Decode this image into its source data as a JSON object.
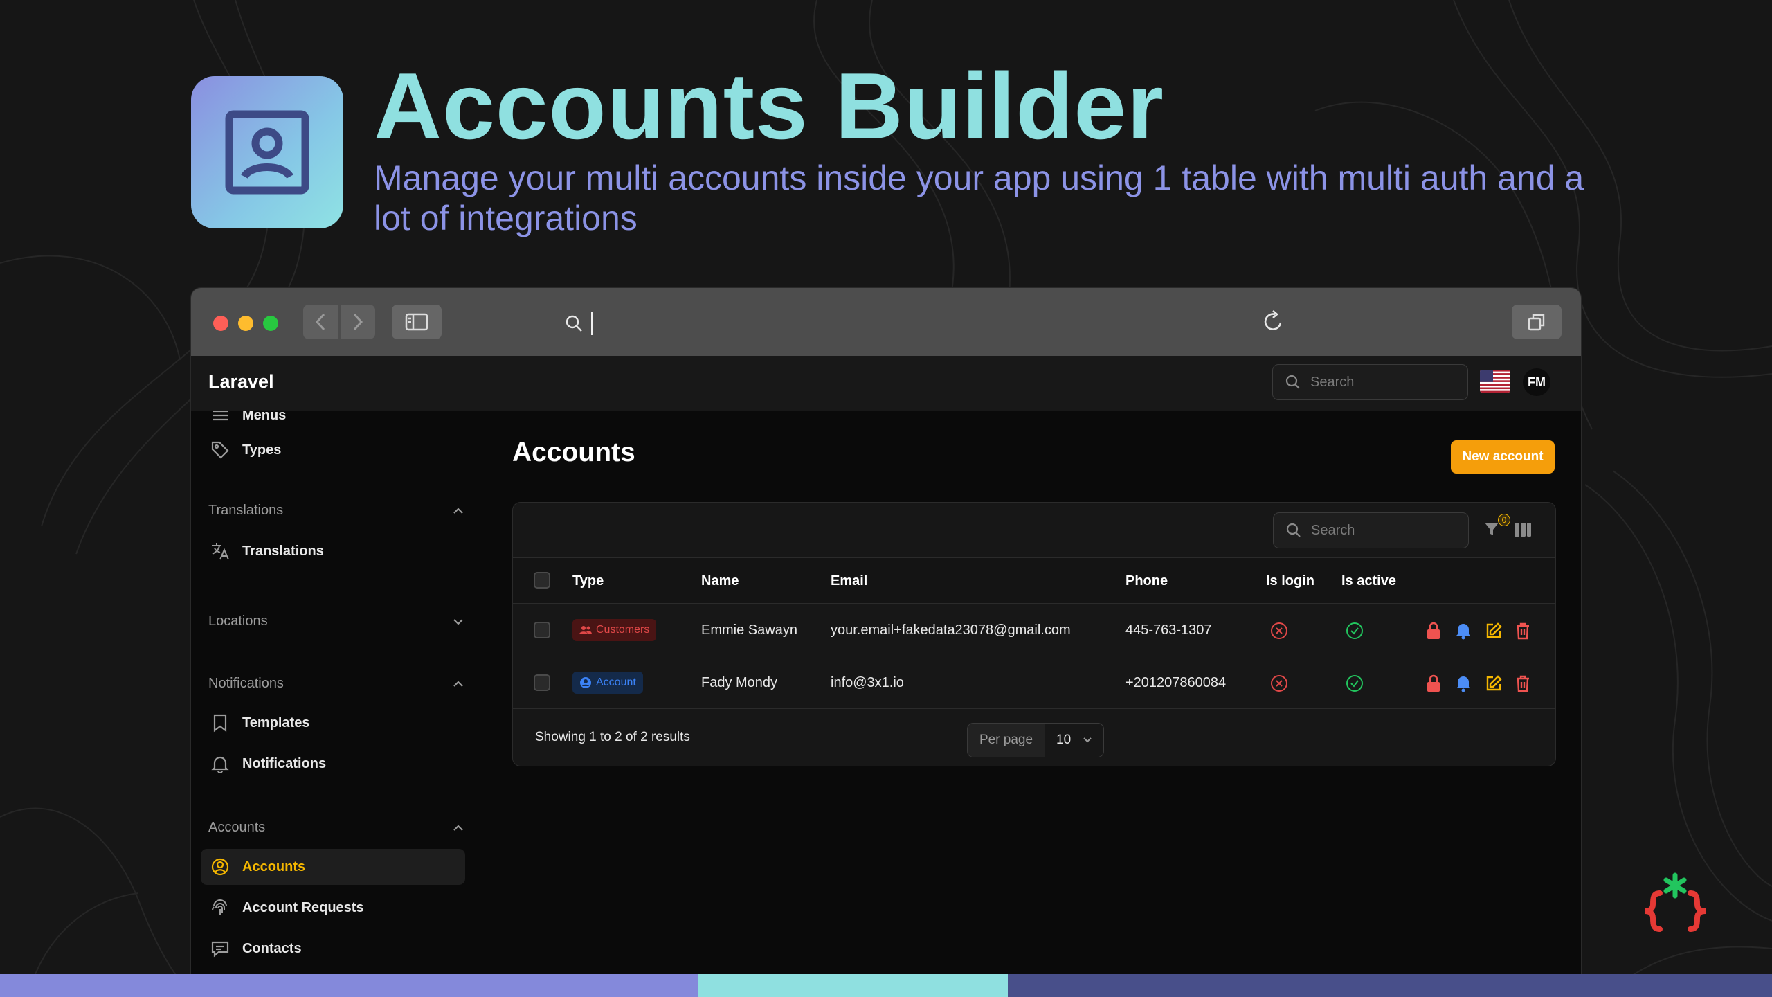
{
  "hero": {
    "title": "Accounts Builder",
    "subtitle": "Manage your multi accounts inside your app using 1 table with multi auth and a lot of integrations"
  },
  "app": {
    "brand": "Laravel",
    "search_placeholder": "Search",
    "avatar_initials": "FM"
  },
  "sidebar": {
    "items_top": [
      {
        "label": "Menus",
        "icon": "menu-icon"
      },
      {
        "label": "Types",
        "icon": "tag-icon"
      }
    ],
    "groups": [
      {
        "label": "Translations",
        "expanded": true,
        "items": [
          {
            "label": "Translations",
            "icon": "translate-icon"
          }
        ]
      },
      {
        "label": "Locations",
        "expanded": false,
        "items": []
      },
      {
        "label": "Notifications",
        "expanded": true,
        "items": [
          {
            "label": "Templates",
            "icon": "bookmark-icon"
          },
          {
            "label": "Notifications",
            "icon": "bell-icon"
          }
        ]
      },
      {
        "label": "Accounts",
        "expanded": true,
        "items": [
          {
            "label": "Accounts",
            "icon": "user-circle-icon",
            "active": true
          },
          {
            "label": "Account Requests",
            "icon": "fingerprint-icon"
          },
          {
            "label": "Contacts",
            "icon": "chat-icon"
          }
        ]
      }
    ]
  },
  "page": {
    "title": "Accounts",
    "new_button": "New account",
    "table_search_placeholder": "Search",
    "filter_count": "0"
  },
  "table": {
    "columns": [
      "Type",
      "Name",
      "Email",
      "Phone",
      "Is login",
      "Is active"
    ],
    "rows": [
      {
        "type": "Customers",
        "type_color": "#e04848",
        "name": "Emmie Sawayn",
        "email": "your.email+fakedata23078@gmail.com",
        "phone": "445-763-1307",
        "is_login": false,
        "is_active": true
      },
      {
        "type": "Account",
        "type_color": "#3b82f6",
        "name": "Fady Mondy",
        "email": "info@3x1.io",
        "phone": "+201207860084",
        "is_login": false,
        "is_active": true
      }
    ],
    "showing": "Showing 1 to 2 of 2 results",
    "per_page_label": "Per page",
    "per_page_value": "10"
  },
  "colors": {
    "accent": "#f59e0b",
    "hero_title": "#8fe0e0",
    "hero_subtitle": "#8c93e6",
    "danger": "#e04848",
    "success": "#22c55e",
    "info": "#3b82f6"
  }
}
